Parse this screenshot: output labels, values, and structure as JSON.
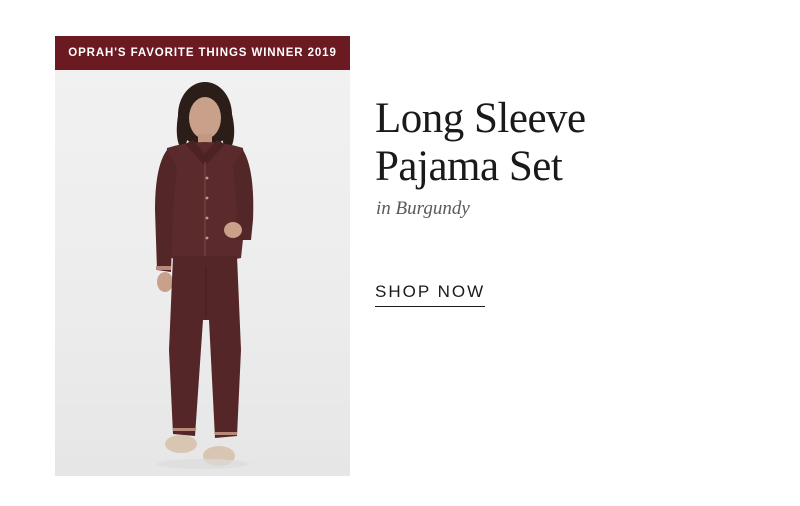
{
  "banner": {
    "text": "OPRAH'S FAVORITE THINGS WINNER 2019"
  },
  "product": {
    "title_line1": "Long Sleeve",
    "title_line2": "Pajama Set",
    "color_label": "in Burgundy",
    "image_description": "model-wearing-burgundy-pajama-set"
  },
  "cta": {
    "label": "SHOP NOW"
  },
  "colors": {
    "banner_bg": "#6b1a22",
    "pajama": "#5a2a2c",
    "text": "#1a1a1a",
    "subtitle": "#5a5a5a"
  }
}
